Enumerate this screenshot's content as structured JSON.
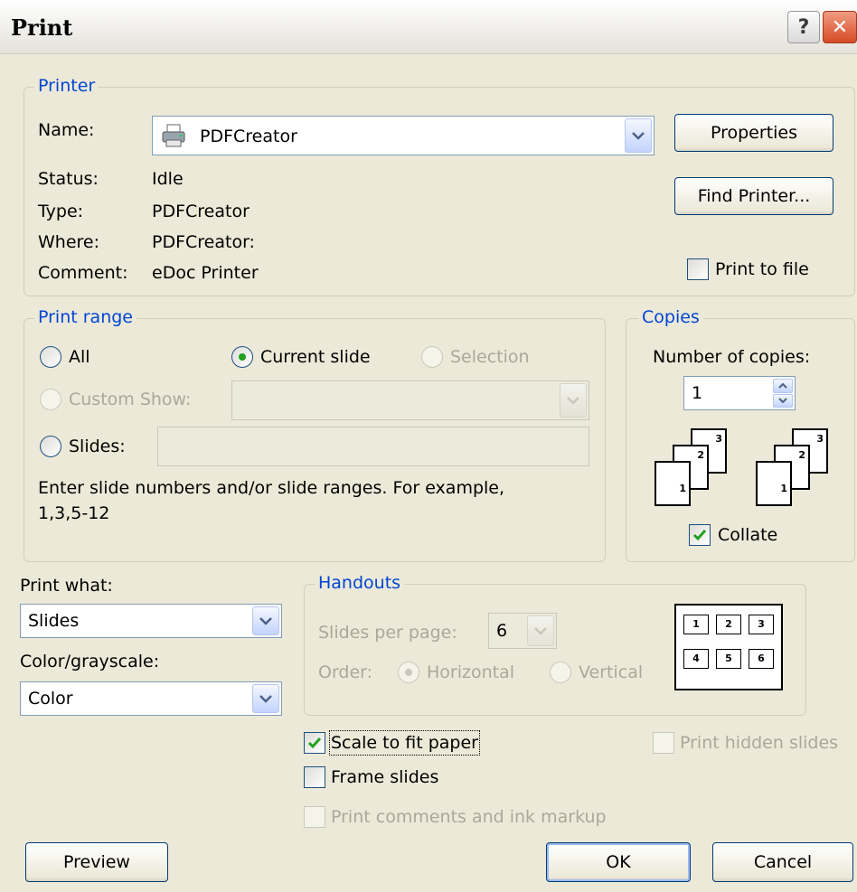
{
  "dialog": {
    "title": "Print"
  },
  "titlebar": {
    "help_glyph": "?",
    "close_glyph": "✕"
  },
  "printer": {
    "group_label": "Printer",
    "name_label": "Name:",
    "name_value": "PDFCreator",
    "status_label": "Status:",
    "status_value": "Idle",
    "type_label": "Type:",
    "type_value": "PDFCreator",
    "where_label": "Where:",
    "where_value": "PDFCreator:",
    "comment_label": "Comment:",
    "comment_value": "eDoc Printer",
    "properties_button": "Properties",
    "find_printer_button": "Find Printer...",
    "print_to_file_label": "Print to file",
    "print_to_file_checked": false
  },
  "print_range": {
    "group_label": "Print range",
    "all_label": "All",
    "current_slide_label": "Current slide",
    "selection_label": "Selection",
    "custom_show_label": "Custom Show:",
    "custom_show_value": "",
    "slides_label": "Slides:",
    "slides_value": "",
    "hint_line1": "Enter slide numbers and/or slide ranges. For example,",
    "hint_line2": "1,3,5-12",
    "selected": "current_slide"
  },
  "copies": {
    "group_label": "Copies",
    "number_label": "Number of copies:",
    "number_value": "1",
    "collate_label": "Collate",
    "collate_checked": true,
    "page_numbers": [
      "1",
      "2",
      "3"
    ]
  },
  "print_what": {
    "label": "Print what:",
    "value": "Slides",
    "color_label": "Color/grayscale:",
    "color_value": "Color"
  },
  "handouts": {
    "group_label": "Handouts",
    "slides_per_page_label": "Slides per page:",
    "slides_per_page_value": "6",
    "order_label": "Order:",
    "horizontal_label": "Horizontal",
    "vertical_label": "Vertical",
    "order_selected": "horizontal",
    "preview_numbers": [
      "1",
      "2",
      "3",
      "4",
      "5",
      "6"
    ]
  },
  "options": {
    "scale_to_fit_label": "Scale to fit paper",
    "scale_to_fit_checked": true,
    "frame_slides_label": "Frame slides",
    "frame_slides_checked": false,
    "print_comments_label": "Print comments and ink markup",
    "print_hidden_label": "Print hidden slides"
  },
  "footer": {
    "preview_button": "Preview",
    "ok_button": "OK",
    "cancel_button": "Cancel"
  },
  "colors": {
    "dialog_bg": "#ece9d8",
    "group_label": "#0046d5",
    "disabled_text": "#aca899",
    "check_mark": "#21a121",
    "close_button": "#d64a25"
  },
  "icons": {
    "printer": "printer-icon",
    "dropdown": "chevron-down-icon",
    "spinner": "spin-arrows-icon",
    "check": "checkmark-icon"
  }
}
